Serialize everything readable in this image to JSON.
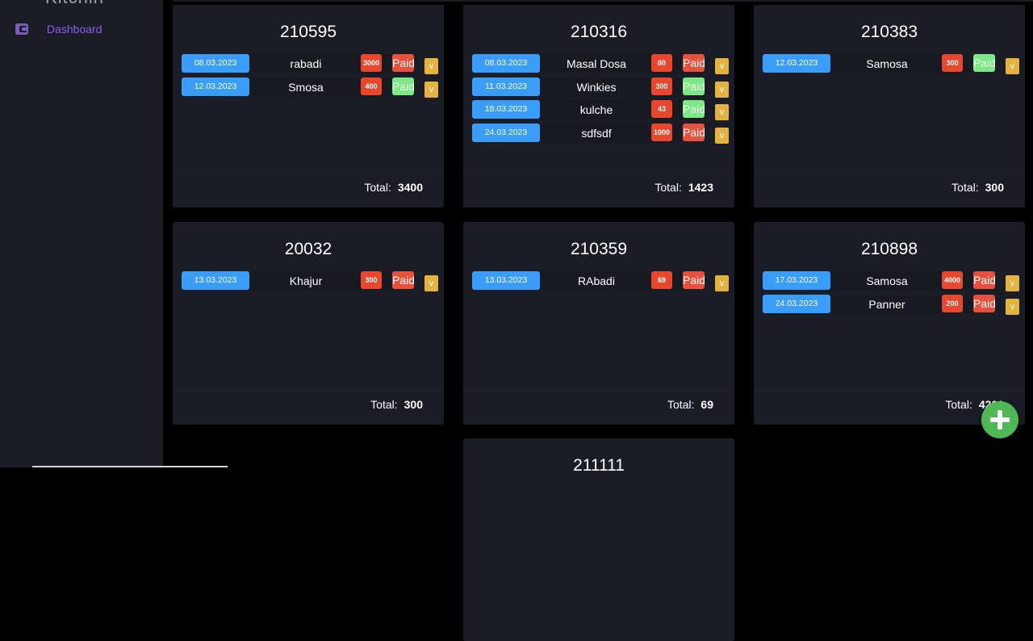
{
  "sidebar": {
    "brand": "Kitchin",
    "nav": [
      {
        "label": "Dashboard",
        "icon": "wallet-icon",
        "active": true
      }
    ]
  },
  "cards": [
    {
      "id": "210595",
      "rows": [
        {
          "date": "08.03.2023",
          "item": "rabadi",
          "amount": "3000",
          "status": "Paid",
          "status_color": "red",
          "action": "v"
        },
        {
          "date": "12.03.2023",
          "item": "Smosa",
          "amount": "400",
          "status": "Paid",
          "status_color": "green",
          "action": "v"
        }
      ],
      "total_label": "Total:",
      "total": "3400"
    },
    {
      "id": "210316",
      "rows": [
        {
          "date": "08.03.2023",
          "item": "Masal Dosa",
          "amount": "80",
          "status": "Paid",
          "status_color": "red",
          "action": "v"
        },
        {
          "date": "11.03.2023",
          "item": "Winkies",
          "amount": "300",
          "status": "Paid",
          "status_color": "green",
          "action": "v"
        },
        {
          "date": "18.03.2023",
          "item": "kulche",
          "amount": "43",
          "status": "Paid",
          "status_color": "green",
          "action": "v"
        },
        {
          "date": "24.03.2023",
          "item": "sdfsdf",
          "amount": "1000",
          "status": "Paid",
          "status_color": "red",
          "action": "v"
        }
      ],
      "total_label": "Total:",
      "total": "1423"
    },
    {
      "id": "210383",
      "rows": [
        {
          "date": "12.03.2023",
          "item": "Samosa",
          "amount": "300",
          "status": "Paid",
          "status_color": "green",
          "action": "v"
        }
      ],
      "total_label": "Total:",
      "total": "300"
    },
    {
      "id": "20032",
      "rows": [
        {
          "date": "13.03.2023",
          "item": "Khajur",
          "amount": "300",
          "status": "Paid",
          "status_color": "red",
          "action": "v"
        }
      ],
      "total_label": "Total:",
      "total": "300"
    },
    {
      "id": "210359",
      "rows": [
        {
          "date": "13.03.2023",
          "item": "RAbadi",
          "amount": "69",
          "status": "Paid",
          "status_color": "red",
          "action": "v"
        }
      ],
      "total_label": "Total:",
      "total": "69"
    },
    {
      "id": "210898",
      "rows": [
        {
          "date": "17.03.2023",
          "item": "Samosa",
          "amount": "4000",
          "status": "Paid",
          "status_color": "red",
          "action": "v"
        },
        {
          "date": "24.03.2023",
          "item": "Panner",
          "amount": "200",
          "status": "Paid",
          "status_color": "red",
          "action": "v"
        }
      ],
      "total_label": "Total:",
      "total": "4200"
    },
    {
      "id": "211111",
      "rows": [],
      "total_label": "",
      "total": ""
    }
  ],
  "fab": {
    "icon": "plus-icon"
  },
  "colors": {
    "sidebar_bg": "#1b1d24",
    "card_bg": "#1b1d26",
    "date_blue": "#3b9dfa",
    "amount_red": "#e8472e",
    "paid_green": "#7ee887",
    "v_yellow": "#e3b240",
    "accent_purple": "#8b5cf6",
    "fab_green": "#4db854"
  }
}
